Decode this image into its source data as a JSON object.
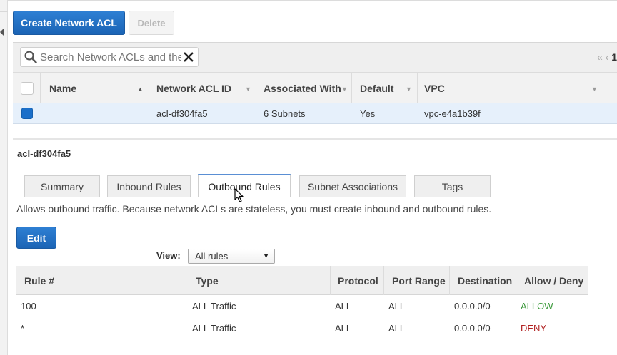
{
  "toolbar": {
    "create_label": "Create Network ACL",
    "delete_label": "Delete"
  },
  "search": {
    "placeholder": "Search Network ACLs and the",
    "clear_icon": "close-icon"
  },
  "pager": {
    "nav_icons": "« ‹",
    "page": "1"
  },
  "acl_table": {
    "columns": [
      "Name",
      "Network ACL ID",
      "Associated With",
      "Default",
      "VPC"
    ],
    "rows": [
      {
        "name": "",
        "id": "acl-df304fa5",
        "associated": "6 Subnets",
        "default": "Yes",
        "vpc": "vpc-e4a1b39f",
        "selected": true
      }
    ]
  },
  "detail": {
    "title": "acl-df304fa5",
    "tabs": [
      "Summary",
      "Inbound Rules",
      "Outbound Rules",
      "Subnet Associations",
      "Tags"
    ],
    "active_tab": "Outbound Rules",
    "description": "Allows outbound traffic. Because network ACLs are stateless, you must create inbound and outbound rules.",
    "edit_label": "Edit",
    "view_label": "View:",
    "view_value": "All rules"
  },
  "rules_table": {
    "columns": [
      "Rule #",
      "Type",
      "Protocol",
      "Port Range",
      "Destination",
      "Allow / Deny"
    ],
    "rows": [
      {
        "rule": "100",
        "type": "ALL Traffic",
        "protocol": "ALL",
        "port": "ALL",
        "dest": "0.0.0.0/0",
        "action": "ALLOW"
      },
      {
        "rule": "*",
        "type": "ALL Traffic",
        "protocol": "ALL",
        "port": "ALL",
        "dest": "0.0.0.0/0",
        "action": "DENY"
      }
    ]
  },
  "colors": {
    "primary": "#1b64b5",
    "allow": "#3c9a3c",
    "deny": "#b02020",
    "selected_row": "#e6f0fb"
  }
}
